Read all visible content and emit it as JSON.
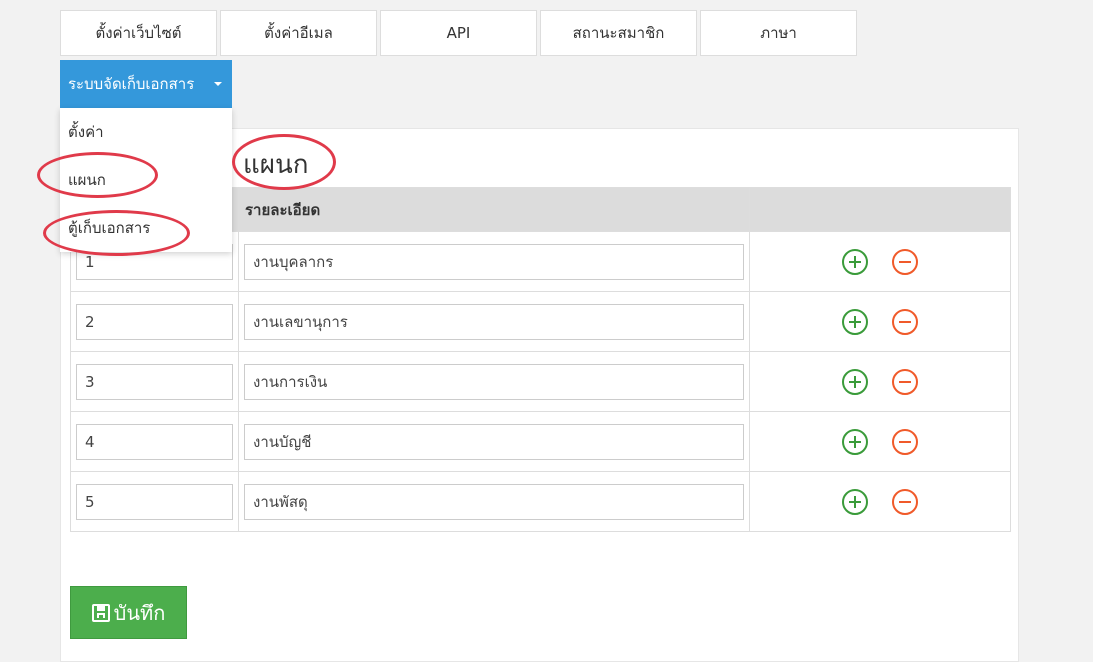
{
  "tabs": [
    "ตั้งค่าเว็บไซต์",
    "ตั้งค่าอีเมล",
    "API",
    "สถานะสมาชิก",
    "ภาษา"
  ],
  "dropdown": {
    "label": "ระบบจัดเก็บเอกสาร",
    "items": [
      "ตั้งค่า",
      "แผนก",
      "ตู้เก็บเอกสาร"
    ]
  },
  "panel": {
    "title": "แผนก",
    "columns": [
      "",
      "รายละเอียด",
      ""
    ],
    "rows": [
      {
        "id": "1",
        "name": "งานบุคลากร"
      },
      {
        "id": "2",
        "name": "งานเลขานุการ"
      },
      {
        "id": "3",
        "name": "งานการเงิน"
      },
      {
        "id": "4",
        "name": "งานบัญชี"
      },
      {
        "id": "5",
        "name": "งานพัสดุ"
      }
    ],
    "add_icon": "plus-circle-icon",
    "remove_icon": "minus-circle-icon"
  },
  "save_button": {
    "label": "บันทึก",
    "icon": "floppy-disk-icon"
  },
  "colors": {
    "accent": "#3498db",
    "save": "#4cae4c",
    "add": "#3a9b3a",
    "remove": "#f05a2a",
    "highlight": "#e03a4a"
  }
}
